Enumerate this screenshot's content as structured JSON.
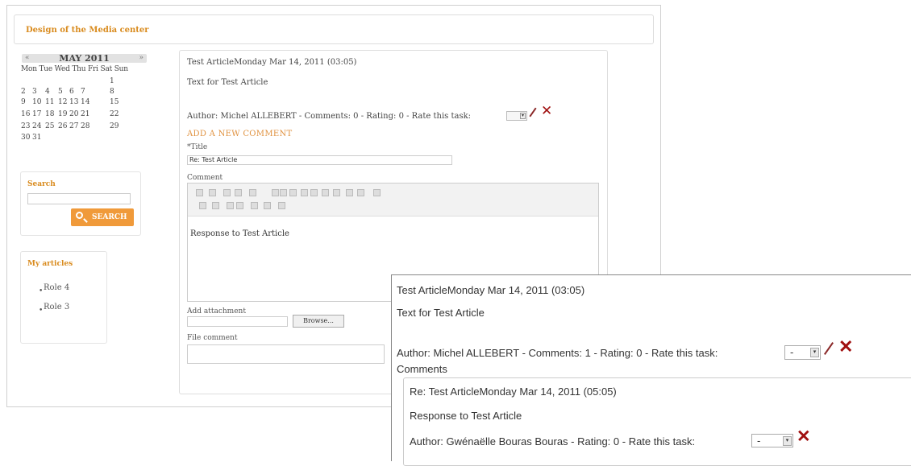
{
  "site": {
    "title": "Design of the Media center"
  },
  "calendar": {
    "prev": "«",
    "next": "»",
    "title": "MAY 2011",
    "days_header": "Mon Tue Wed Thu Fri Sat Sun",
    "rows": [
      [
        "",
        "",
        "",
        "",
        "",
        "",
        "1"
      ],
      [
        "2",
        "3",
        "4",
        "5",
        "6",
        "7",
        "8"
      ],
      [
        "9",
        "10",
        "11",
        "12",
        "13",
        "14",
        "15"
      ],
      [
        "16",
        "17",
        "18",
        "19",
        "20",
        "21",
        "22"
      ],
      [
        "23",
        "24",
        "25",
        "26",
        "27",
        "28",
        "29"
      ],
      [
        "30",
        "31",
        "",
        "",
        "",
        "",
        ""
      ]
    ]
  },
  "search": {
    "label": "Search",
    "button_label": "SEARCH"
  },
  "my_articles": {
    "label": "My articles",
    "items": [
      {
        "label": "Role 4"
      },
      {
        "label": "Role 3"
      }
    ]
  },
  "article": {
    "title": "Test ArticleMonday  Mar 14, 2011 (03:05)",
    "body": "Text for Test Article",
    "meta": "Author: Michel ALLEBERT - Comments: 0 - Rating: 0 - Rate this task:",
    "rate_value": ""
  },
  "comment_form": {
    "heading": "ADD A NEW COMMENT",
    "title_label": "*Title",
    "title_value": "Re: Test Article",
    "comment_label": "Comment",
    "editor_text": "Response to Test Article",
    "attach_label": "Add attachment",
    "browse_label": "Browse...",
    "file_comment_label": "File comment"
  },
  "overlay": {
    "title": "Test ArticleMonday  Mar 14, 2011 (03:05)",
    "body": "Text for Test Article",
    "meta": "Author: Michel ALLEBERT - Comments: 1 - Rating: 0 - Rate this task:",
    "rate_value": "-",
    "comments_label": "Comments",
    "reply": {
      "title": "Re: Test ArticleMonday Mar 14, 2011 (05:05)",
      "body": "Response to Test Article",
      "meta": "Author: Gwénaëlle Bouras Bouras - Rating: 0 - Rate this task:",
      "rate_value": "-"
    }
  },
  "colors": {
    "accent": "#d98b1e",
    "search_button": "#f09a3a",
    "delete": "#a01010"
  }
}
